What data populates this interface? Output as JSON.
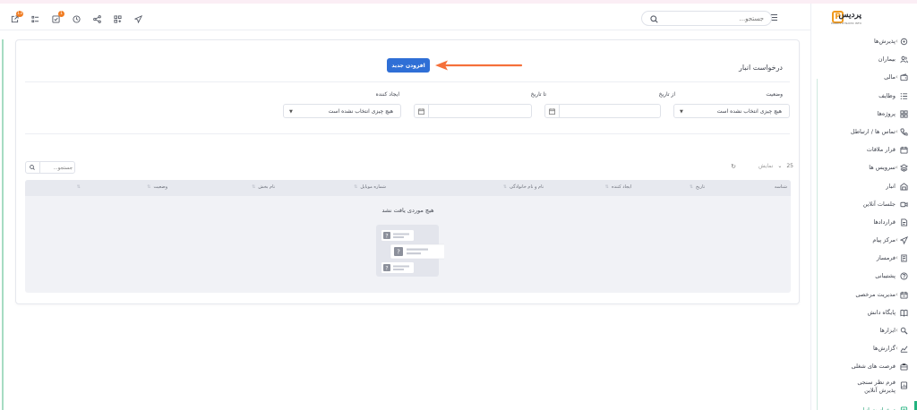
{
  "topbar": {
    "search_placeholder": "جستجو...",
    "badges": {
      "notifications": "13",
      "tasks": "1"
    }
  },
  "sidebar": {
    "brand": "پردیس",
    "brand_sub": "PARDIS DYNAMIC INFO",
    "items": [
      {
        "label": "پذیرش‌ها",
        "icon": "target-icon",
        "chevron": true
      },
      {
        "label": "بیماران",
        "icon": "users-icon",
        "chevron": false
      },
      {
        "label": "مالی",
        "icon": "wallet-icon",
        "chevron": true
      },
      {
        "label": "وظایف",
        "icon": "list-icon",
        "chevron": false
      },
      {
        "label": "پروژه‌ها",
        "icon": "grid-icon",
        "chevron": false
      },
      {
        "label": "تماس ها / ارتباطل",
        "icon": "phone-icon",
        "chevron": true
      },
      {
        "label": "قرار ملاقات",
        "icon": "calendar-icon",
        "chevron": false
      },
      {
        "label": "سرویس ها",
        "icon": "layers-icon",
        "chevron": true
      },
      {
        "label": "انبار",
        "icon": "warehouse-icon",
        "chevron": false
      },
      {
        "label": "جلسات آنلاین",
        "icon": "video-icon",
        "chevron": false
      },
      {
        "label": "قراردادها",
        "icon": "contract-icon",
        "chevron": false
      },
      {
        "label": "مرکز پیام",
        "icon": "send-icon",
        "chevron": true
      },
      {
        "label": "فرمساز",
        "icon": "form-icon",
        "chevron": true
      },
      {
        "label": "پشتیبانی",
        "icon": "help-icon",
        "chevron": false
      },
      {
        "label": "مدیریت مرخصی",
        "icon": "leave-icon",
        "chevron": true
      },
      {
        "label": "پایگاه دانش",
        "icon": "book-icon",
        "chevron": false
      },
      {
        "label": "ابزارها",
        "icon": "tools-icon",
        "chevron": true
      },
      {
        "label": "گزارش‌ها",
        "icon": "chart-icon",
        "chevron": true
      },
      {
        "label": "فرصت های شغلی",
        "icon": "briefcase-icon",
        "chevron": false
      },
      {
        "label": "فرم نظر سنجی پذیرش آنلاین",
        "icon": "survey-icon",
        "chevron": false,
        "two_line": true
      },
      {
        "label": "درخواست انبار",
        "icon": "request-icon",
        "chevron": false,
        "active": true
      }
    ]
  },
  "page": {
    "title": "درخواست انبار",
    "add_button": "افزودن جدید"
  },
  "filters": {
    "status_label": "وضعیت",
    "status_value": "هیچ چیزی انتخاب نشده است",
    "from_date_label": "از تاریخ",
    "to_date_label": "تا تاریخ",
    "creator_label": "ایجاد کننده",
    "creator_value": "هیچ چیزی انتخاب نشده است"
  },
  "table": {
    "per_page": "25",
    "per_page_label": "نمایش",
    "search_placeholder": "جستجو...",
    "columns": [
      "شناسه",
      "تاریخ",
      "ایجاد کننده",
      "نام و نام خانوادگی",
      "شماره موبایل",
      "نام بخش",
      "وضعیت",
      ""
    ],
    "empty_message": "هیچ موردی یافت نشد"
  },
  "colors": {
    "primary": "#2f6fd6",
    "accent_arrow": "#f5703a",
    "active_green": "#22b37f",
    "badge_orange": "#f07c22",
    "brand_orange": "#f09a1e"
  }
}
